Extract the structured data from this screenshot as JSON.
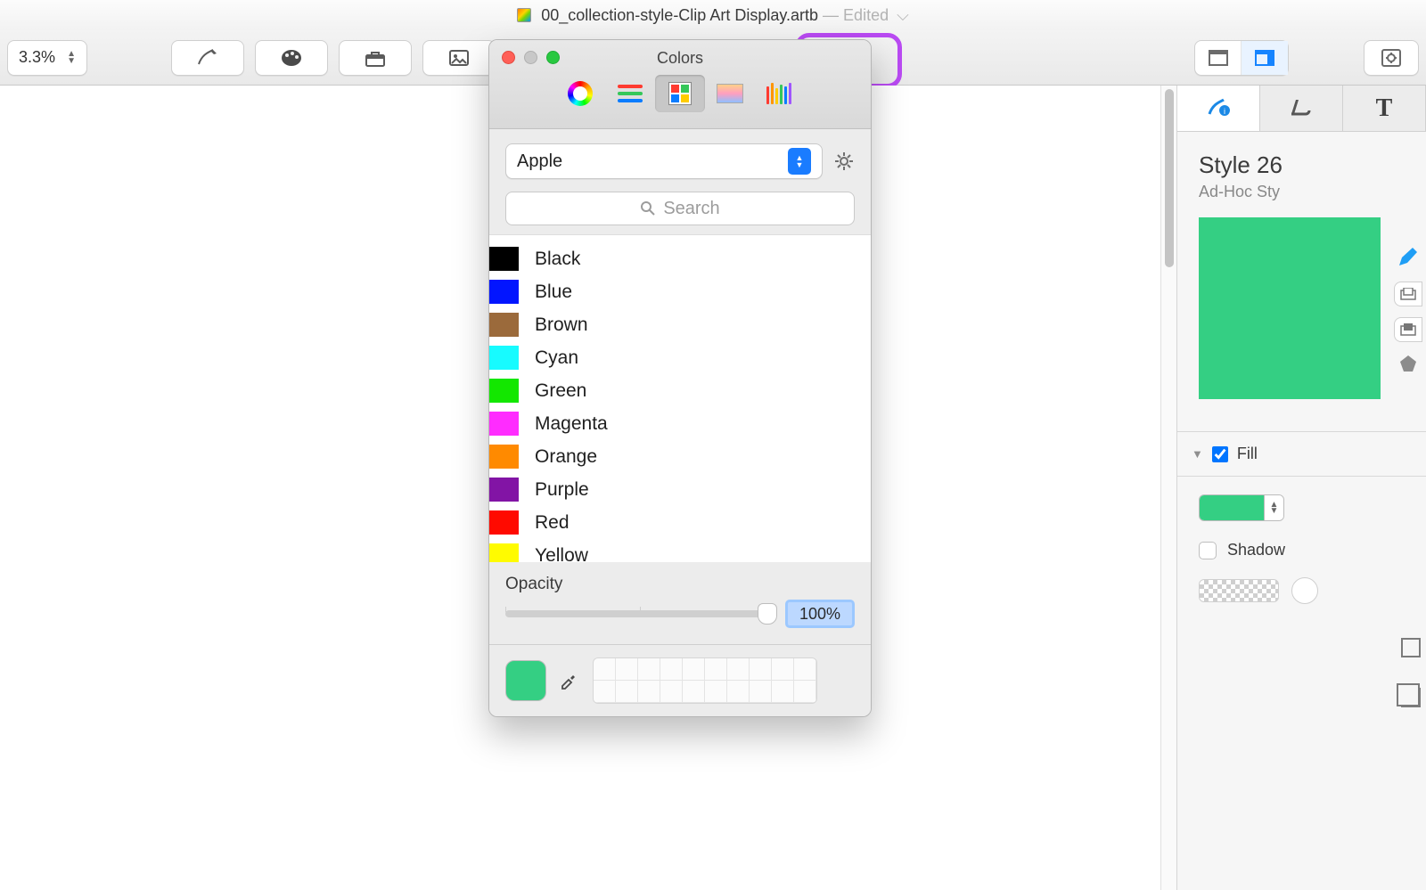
{
  "title": {
    "filename": "00_collection-style-Clip Art Display.artb",
    "edited_suffix": "— Edited"
  },
  "toolbar": {
    "zoom": "3.3%"
  },
  "colors_panel": {
    "title": "Colors",
    "palette_name": "Apple",
    "search_placeholder": "Search",
    "swatches": [
      {
        "name": "Black",
        "hex": "#000000"
      },
      {
        "name": "Blue",
        "hex": "#0215ff"
      },
      {
        "name": "Brown",
        "hex": "#9b6a3b"
      },
      {
        "name": "Cyan",
        "hex": "#17fbff"
      },
      {
        "name": "Green",
        "hex": "#13e700"
      },
      {
        "name": "Magenta",
        "hex": "#ff2cff"
      },
      {
        "name": "Orange",
        "hex": "#ff8a00"
      },
      {
        "name": "Purple",
        "hex": "#8214a5"
      },
      {
        "name": "Red",
        "hex": "#ff0a00"
      },
      {
        "name": "Yellow",
        "hex": "#fffb00"
      }
    ],
    "opacity_label": "Opacity",
    "opacity_value": "100%",
    "current_color": "#34cf83"
  },
  "inspector": {
    "style_title": "Style 26",
    "style_subtitle": "Ad-Hoc Sty",
    "fill_label": "Fill",
    "fill_enabled": true,
    "fill_color": "#34cf83",
    "shadow_label": "Shadow"
  }
}
